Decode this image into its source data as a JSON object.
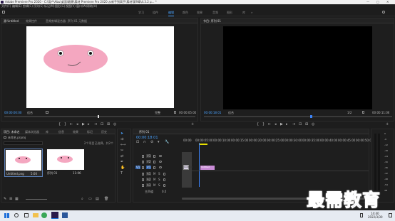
{
  "titlebar": {
    "title": "Adobe Premiere Pro 2020 - C:\\用户\\Abu\\桌面\\最需\\素材 Premiere Pro 2020 从新手到高手\\素材\\第9章\\4.3.2 μ… *"
  },
  "menu": [
    "文件(F)",
    "编辑(E)",
    "剪辑(C)",
    "序列(S)",
    "标记(M)",
    "图形(G)",
    "视图(V)",
    "窗口(W)",
    "帮助(H)"
  ],
  "workspaces": [
    "学习",
    "组件",
    "编辑",
    "颜色",
    "效果",
    "音频",
    "图形",
    "库"
  ],
  "source": {
    "tabs": [
      "源:Untitled",
      "效果控件",
      "音频剪辑混合器: 序列 01",
      "元数据"
    ],
    "timecode_in": "00:00:00:00",
    "fit": "适合",
    "full": "完整",
    "timecode_out": "00:00:05:00"
  },
  "program": {
    "tab": "节目: 序列 01",
    "timecode_in": "00:00:18:01",
    "fit": "适合",
    "ratio": "1/2",
    "timecode_out": "00:00:11:06"
  },
  "project": {
    "tabs": [
      "项目: 未命名",
      "媒体浏览器",
      "库",
      "信息",
      "效果",
      "标记",
      "历史"
    ],
    "file": "未命名.prproj",
    "count": "2个项目已选择，共2个",
    "search_placeholder": "",
    "item1_name": "Untitled.png",
    "item1_dur": "5:00",
    "item2_name": "序列 01",
    "item2_dur": "11:06"
  },
  "timeline": {
    "seq_tab": "序列 01",
    "timecode": "00:00:18:01",
    "ruler": [
      "00:00",
      "00:00:05:00",
      "00:00:10:00",
      "00:00:15:00",
      "00:00:20:00",
      "00:00:25:00",
      "00:00:30:00",
      "00:00:35:00",
      "00:00:40:00",
      "00:00:45:00",
      "00:00:50:00",
      "00:00:55:00"
    ],
    "video_tracks": [
      "V3",
      "V2",
      "V1"
    ],
    "audio_tracks": [
      "A1",
      "A2",
      "A3"
    ],
    "master_label": "主声道",
    "master_val": "0.0",
    "clip_v1": "Untitled",
    "clip_pink": "Untitled"
  },
  "meter": {
    "labels": [
      "0",
      "-6",
      "-12",
      "-18",
      "-24",
      "-30",
      "-36",
      "-42",
      "-48",
      "-54",
      "dB"
    ],
    "sr": "S S"
  },
  "watermark": {
    "text": "最需教育"
  },
  "taskbar": {
    "time": "14:40",
    "date": "2022/3/30"
  },
  "colors": {
    "accent": "#4aa3ff",
    "timeline_clip_pink": "#c98bd6",
    "playhead": "#3b82f6"
  }
}
